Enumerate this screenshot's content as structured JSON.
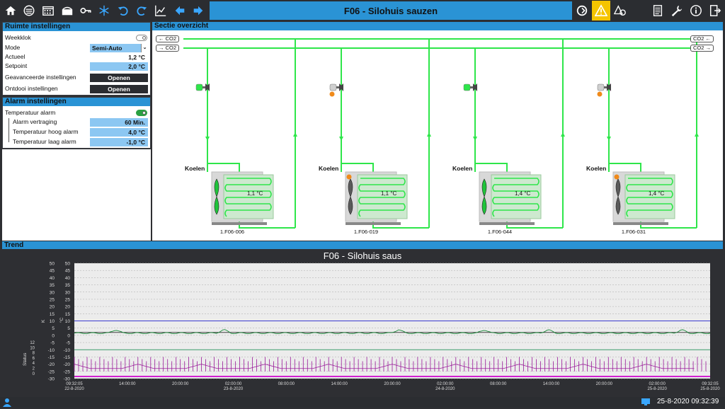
{
  "header": {
    "title": "F06 - Silohuis sauzen",
    "left_icons": [
      "home-icon",
      "dashboard-icon",
      "calendar-icon",
      "container-icon",
      "key-icon",
      "snowflake-icon",
      "undo-icon",
      "redo-icon",
      "chart-icon",
      "arrow-left-icon",
      "arrow-right-icon"
    ],
    "right_icons": [
      "refresh-icon",
      "warning-icon",
      "shapes-icon",
      "report-icon",
      "wrench-icon",
      "info-icon",
      "exit-icon"
    ]
  },
  "ruimte": {
    "title": "Ruimte instellingen",
    "weekklok_label": "Weekklok",
    "mode_label": "Mode",
    "mode_value": "Semi-Auto",
    "actueel_label": "Actueel",
    "actueel_value": "1,2 °C",
    "setpoint_label": "Setpoint",
    "setpoint_value": "2,0 °C",
    "geavanceerd_label": "Geavanceerde instellingen",
    "geavanceerd_button": "Openen",
    "ontdooi_label": "Ontdooi instellingen",
    "ontdooi_button": "Openen"
  },
  "alarm": {
    "title": "Alarm instellingen",
    "temp_alarm_label": "Temperatuur alarm",
    "vertraging_label": "Alarm vertraging",
    "vertraging_value": "60 Min.",
    "hoog_label": "Temperatuur hoog alarm",
    "hoog_value": "4,0 °C",
    "laag_label": "Temperatuur laag alarm",
    "laag_value": "-1,0 °C"
  },
  "sectie": {
    "title": "Sectie overzicht",
    "co2_tags": [
      "← CO2",
      "→ CO2",
      "CO2 ←",
      "CO2 →"
    ],
    "units": [
      {
        "label": "Koelen",
        "temp": "1,1 °C",
        "id": "1.F06-006",
        "alarm": false,
        "fan_active": true
      },
      {
        "label": "Koelen",
        "temp": "1,1 °C",
        "id": "1.F06-019",
        "alarm": true,
        "fan_active": false
      },
      {
        "label": "Koelen",
        "temp": "1,4 °C",
        "id": "1.F06-044",
        "alarm": false,
        "fan_active": true
      },
      {
        "label": "Koelen",
        "temp": "1,4 °C",
        "id": "1.F06-031",
        "alarm": true,
        "fan_active": false
      }
    ]
  },
  "trend": {
    "title": "Trend",
    "chart_title": "F06 - Silohuis saus",
    "left_axis1_label": "K",
    "left_axis2_label": "°C",
    "status_label": "Status",
    "y_ticks": [
      50,
      45,
      40,
      35,
      30,
      25,
      20,
      15,
      10,
      5,
      0,
      -5,
      -10,
      -15,
      -20,
      -25,
      -30
    ],
    "status_ticks": [
      12,
      10,
      8,
      6,
      4,
      2,
      0
    ],
    "x_ticks": [
      {
        "t": "09:32:05",
        "d": "22-8-2020"
      },
      {
        "t": "14:00:00",
        "d": ""
      },
      {
        "t": "20:00:00",
        "d": ""
      },
      {
        "t": "02:00:00",
        "d": "23-8-2020"
      },
      {
        "t": "08:00:00",
        "d": ""
      },
      {
        "t": "14:00:00",
        "d": ""
      },
      {
        "t": "20:00:00",
        "d": ""
      },
      {
        "t": "02:00:00",
        "d": "24-8-2020"
      },
      {
        "t": "08:00:00",
        "d": ""
      },
      {
        "t": "14:00:00",
        "d": ""
      },
      {
        "t": "20:00:00",
        "d": ""
      },
      {
        "t": "02:00:00",
        "d": "25-8-2020"
      },
      {
        "t": "09:32:05",
        "d": "25-8-2020"
      }
    ]
  },
  "statusbar": {
    "datetime": "25-8-2020 09:32:39"
  },
  "colors": {
    "accent": "#2a93d5",
    "pipe": "#2ee64a",
    "warning": "#f5c400",
    "trend_green": "#1a8a3a",
    "trend_purple": "#9a1a9a",
    "trend_blue": "#3a3ad0"
  },
  "chart_data": {
    "type": "line",
    "title": "F06 - Silohuis saus",
    "ylabel": "°C",
    "ylim": [
      -30,
      50
    ],
    "x": [
      "22-8-2020 09:32:05",
      "22-8-2020 14:00:00",
      "22-8-2020 20:00:00",
      "23-8-2020 02:00:00",
      "23-8-2020 08:00:00",
      "23-8-2020 14:00:00",
      "23-8-2020 20:00:00",
      "24-8-2020 02:00:00",
      "24-8-2020 08:00:00",
      "24-8-2020 14:00:00",
      "24-8-2020 20:00:00",
      "25-8-2020 02:00:00",
      "25-8-2020 09:32:05"
    ],
    "series": [
      {
        "values": [
          2,
          2,
          2,
          2,
          2,
          2,
          2,
          2,
          2,
          2,
          2,
          2,
          2
        ]
      },
      {
        "values": [
          1.5,
          3,
          1.5,
          1.3,
          1.5,
          3,
          1.4,
          1.3,
          1.6,
          3,
          1.4,
          1.3,
          1.5
        ]
      },
      {
        "values": [
          10,
          10,
          10,
          10,
          10,
          10,
          10,
          10,
          10,
          10,
          10,
          10,
          10
        ]
      },
      {
        "values": [
          -10,
          -10,
          -10,
          -10,
          -10,
          -10,
          -10,
          -10,
          -10,
          -10,
          -10,
          -10,
          -10
        ]
      }
    ],
    "grid": true
  }
}
